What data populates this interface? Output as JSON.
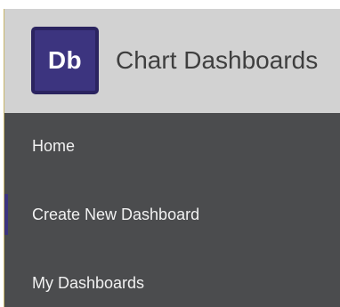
{
  "app": {
    "logo_text": "Db",
    "title": "Chart Dashboards"
  },
  "nav": {
    "items": [
      {
        "label": "Home"
      },
      {
        "label": "Create New Dashboard",
        "active": true
      },
      {
        "label": "My Dashboards"
      }
    ]
  },
  "colors": {
    "header_bg": "#d2d2d2",
    "nav_bg": "#4b4c4e",
    "brand": "#3c347f",
    "nav_text": "#f1f1f1",
    "title_text": "#3f3f3f"
  }
}
